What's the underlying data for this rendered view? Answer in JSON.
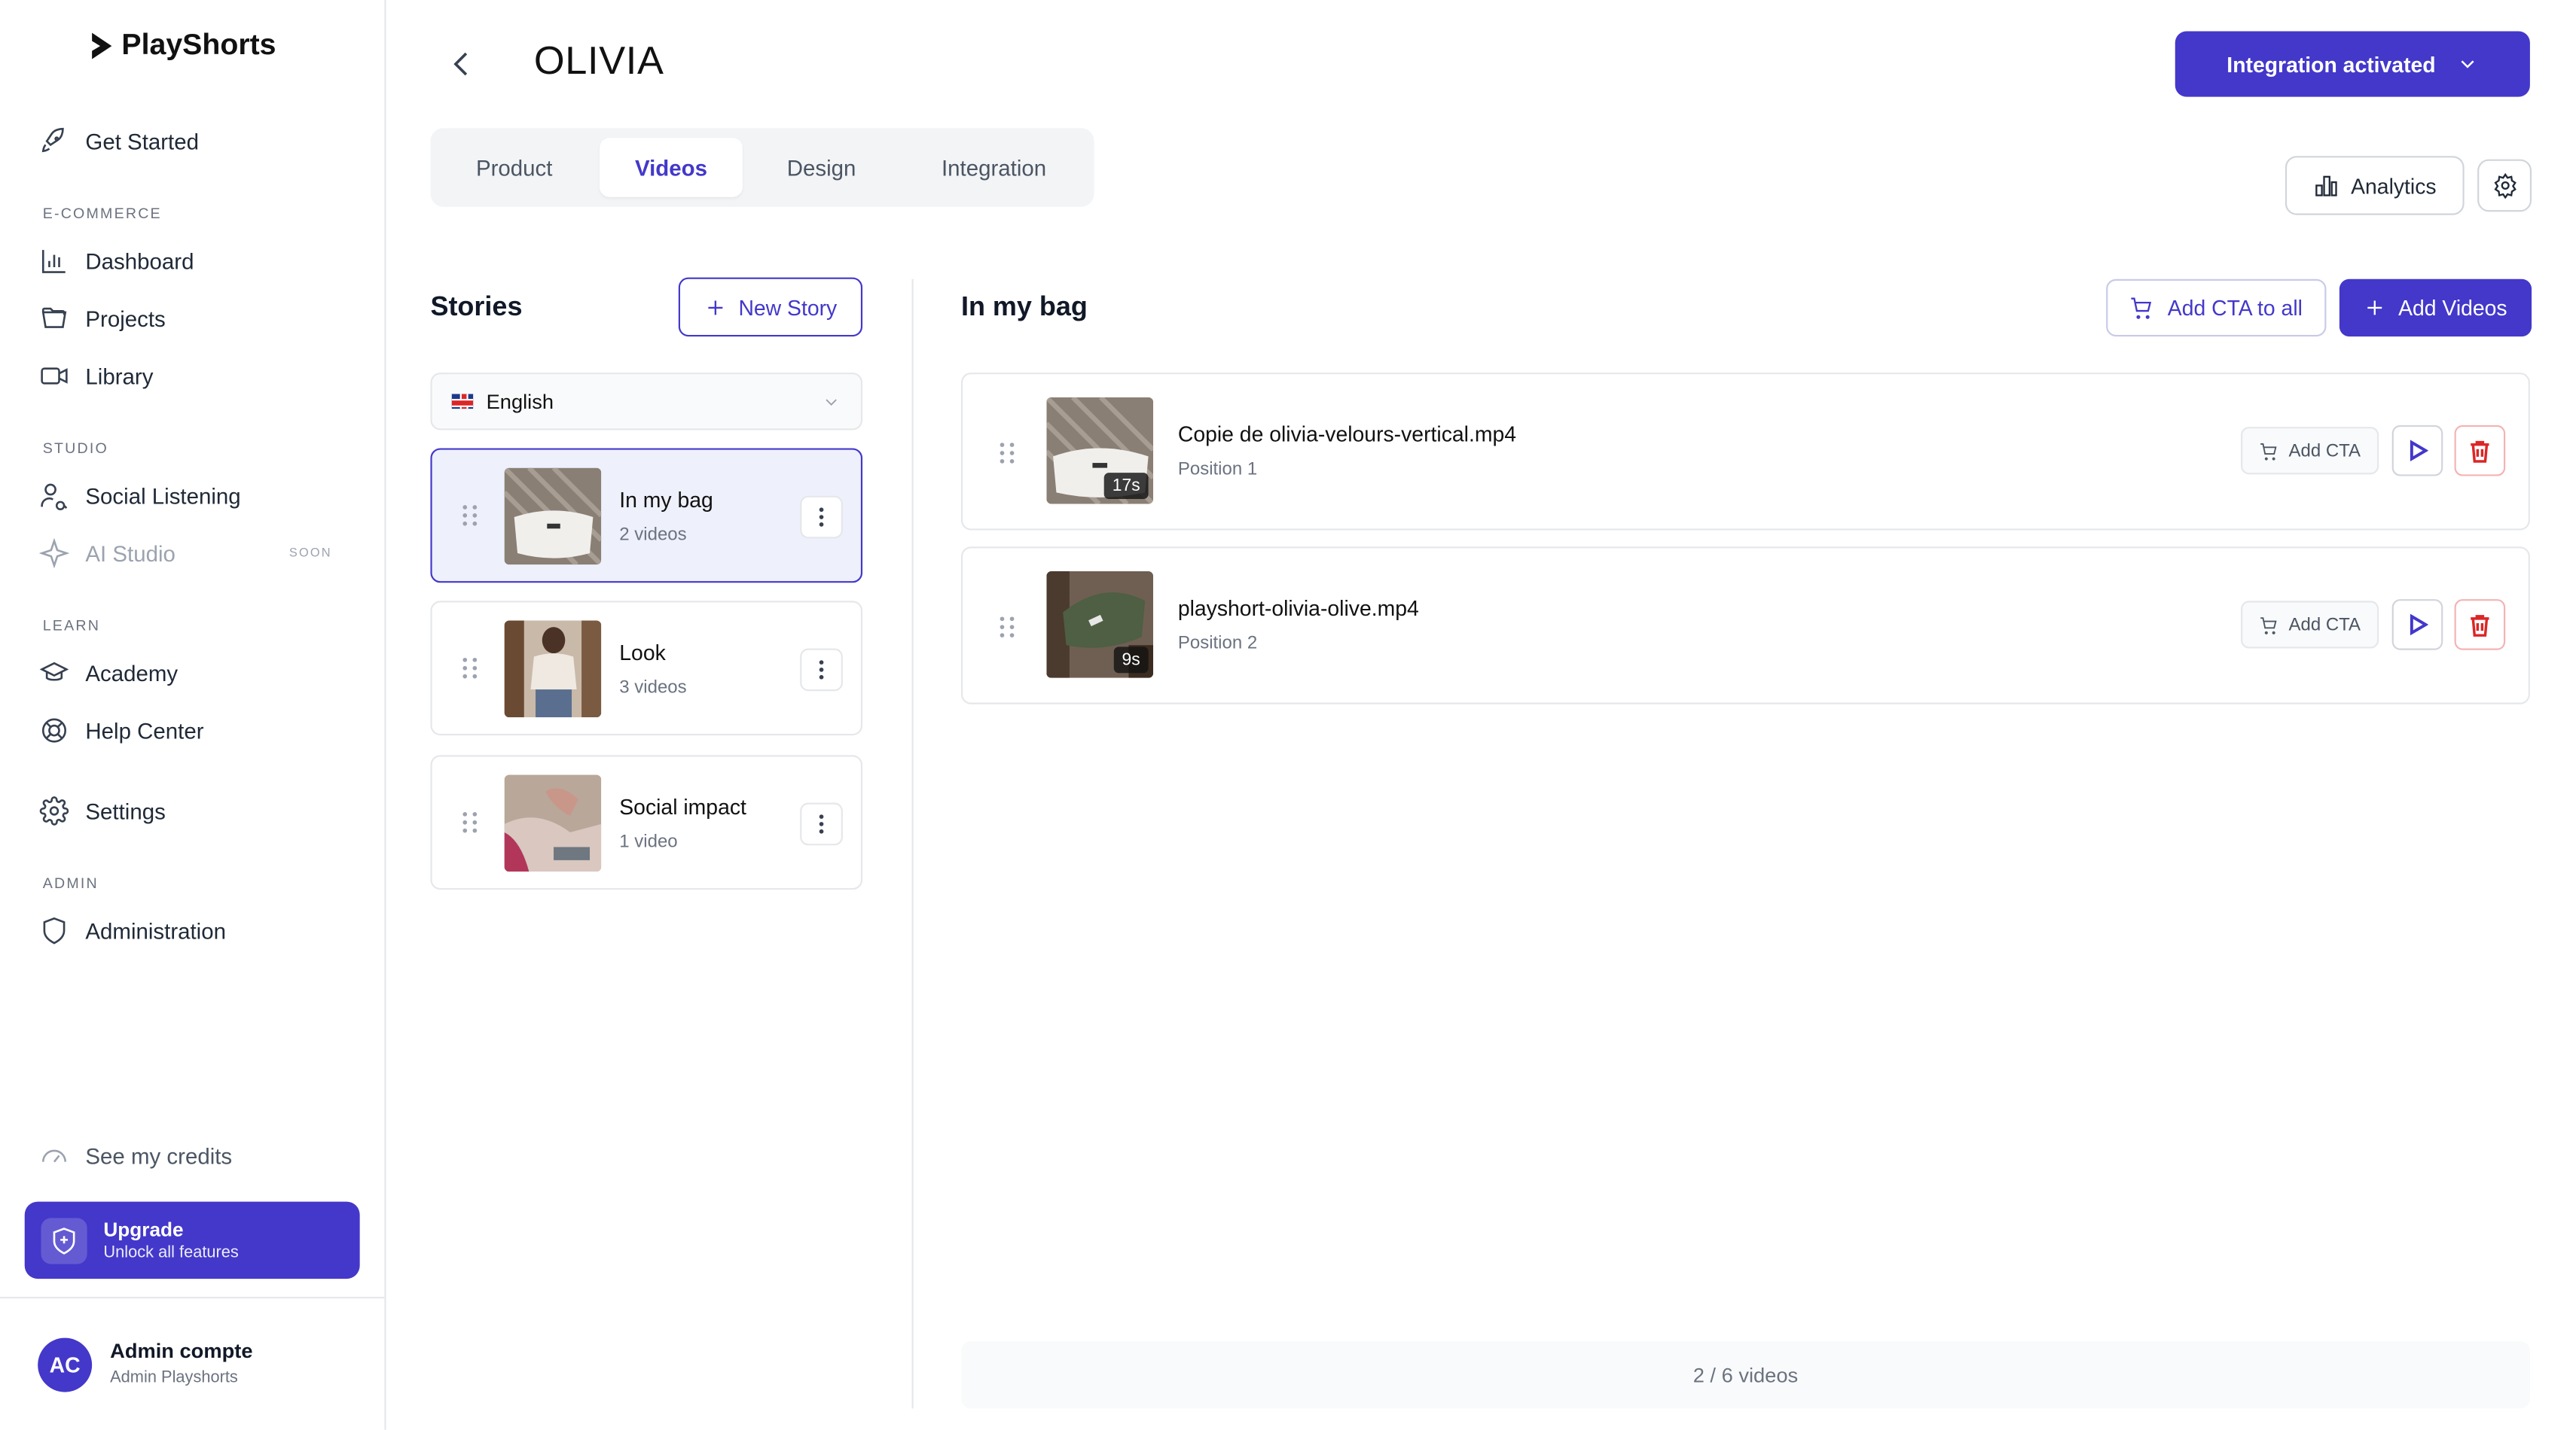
{
  "app": {
    "name": "PlayShorts"
  },
  "sidebar": {
    "get_started": "Get Started",
    "sections": {
      "ecommerce": "E-COMMERCE",
      "studio": "STUDIO",
      "learn": "LEARN",
      "admin": "ADMIN"
    },
    "items": {
      "dashboard": "Dashboard",
      "projects": "Projects",
      "library": "Library",
      "social_listening": "Social Listening",
      "ai_studio": "AI Studio",
      "ai_studio_badge": "SOON",
      "academy": "Academy",
      "help_center": "Help Center",
      "settings": "Settings",
      "administration": "Administration"
    },
    "credits": "See my credits",
    "upgrade": {
      "title": "Upgrade",
      "subtitle": "Unlock all features"
    },
    "user": {
      "initials": "AC",
      "name": "Admin compte",
      "role": "Admin Playshorts"
    }
  },
  "header": {
    "title": "OLIVIA",
    "integration_button": "Integration activated",
    "analytics_button": "Analytics",
    "tabs": [
      {
        "label": "Product"
      },
      {
        "label": "Videos"
      },
      {
        "label": "Design"
      },
      {
        "label": "Integration"
      }
    ],
    "active_tab": "Videos"
  },
  "stories": {
    "title": "Stories",
    "new_button": "New Story",
    "language": "English",
    "items": [
      {
        "name": "In my bag",
        "count": "2 videos"
      },
      {
        "name": "Look",
        "count": "3 videos"
      },
      {
        "name": "Social impact",
        "count": "1 video"
      }
    ]
  },
  "videos_panel": {
    "title": "In my bag",
    "add_cta_all": "Add CTA to all",
    "add_videos": "Add Videos",
    "cta_label": "Add CTA",
    "items": [
      {
        "filename": "Copie de olivia-velours-vertical.mp4",
        "position": "Position 1",
        "duration": "17s"
      },
      {
        "filename": "playshort-olivia-olive.mp4",
        "position": "Position 2",
        "duration": "9s"
      }
    ],
    "footer": "2 / 6 videos"
  },
  "colors": {
    "accent": "#4338ca",
    "danger": "#dc2626"
  }
}
